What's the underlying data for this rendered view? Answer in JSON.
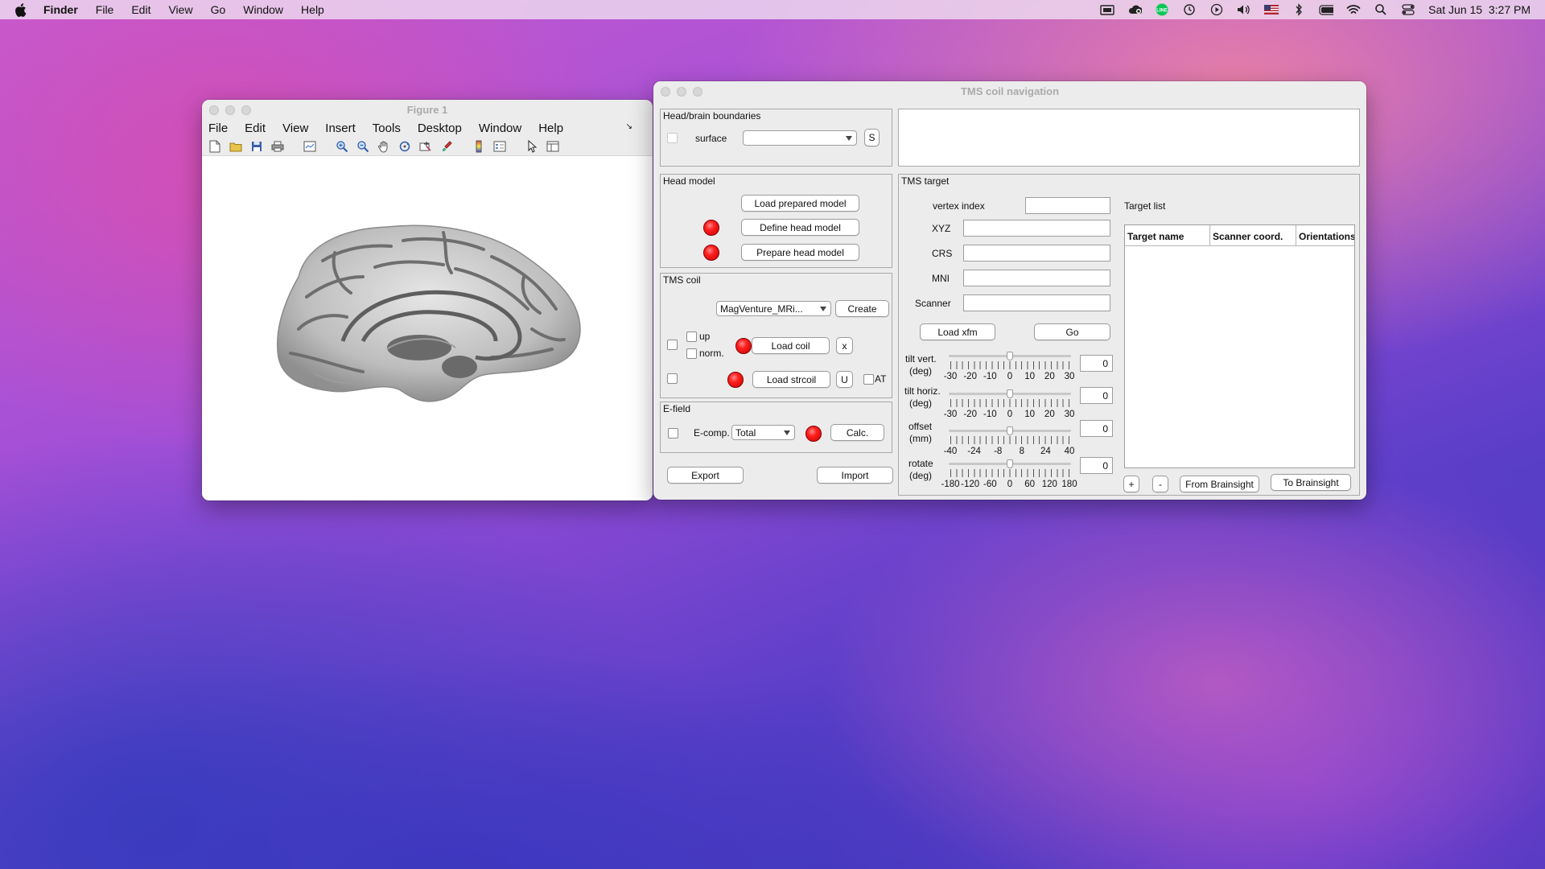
{
  "menubar": {
    "items": [
      "Finder",
      "File",
      "Edit",
      "View",
      "Go",
      "Window",
      "Help"
    ],
    "clock": "Sat Jun 15  3:27 PM",
    "status_icons": [
      "display-icon",
      "cloud-icon",
      "line-app-icon",
      "time-machine-icon",
      "play-icon",
      "volume-icon",
      "flag-us-icon",
      "bluetooth-icon",
      "battery-icon",
      "wifi-icon",
      "spotlight-icon",
      "control-center-icon"
    ]
  },
  "figure": {
    "title": "Figure 1",
    "menu": [
      "File",
      "Edit",
      "View",
      "Insert",
      "Tools",
      "Desktop",
      "Window",
      "Help"
    ],
    "corner_glyph": "↘",
    "toolbar_icons": [
      "new-figure-icon",
      "open-file-icon",
      "save-icon",
      "print-icon",
      "link-plot-icon",
      "zoom-in-icon",
      "zoom-out-icon",
      "pan-icon",
      "rotate-3d-icon",
      "data-cursor-icon",
      "brush-icon",
      "colorbar-icon",
      "legend-icon",
      "edit-plot-icon",
      "property-inspector-icon"
    ]
  },
  "tms": {
    "title": "TMS coil navigation",
    "boundaries": {
      "title": "Head/brain boundaries",
      "surface_label": "surface",
      "surface_value": "",
      "s_button": "S"
    },
    "head_model": {
      "title": "Head model",
      "load_button": "Load prepared model",
      "define_button": "Define head model",
      "prepare_button": "Prepare head model"
    },
    "coil": {
      "title": "TMS coil",
      "coil_select": "MagVenture_MRi...",
      "create_button": "Create",
      "up_label": "up",
      "norm_label": "norm.",
      "load_coil_button": "Load coil",
      "x_button": "x",
      "load_strcoil_button": "Load strcoil",
      "u_button": "U",
      "at_label": "AT"
    },
    "efield": {
      "title": "E-field",
      "ecomp_label": "E-comp.",
      "ecomp_select": "Total",
      "calc_button": "Calc."
    },
    "export_button": "Export",
    "import_button": "Import",
    "target": {
      "title": "TMS target",
      "vertex_label": "vertex index",
      "vertex_value": "",
      "xyz_label": "XYZ",
      "xyz_value": "",
      "crs_label": "CRS",
      "crs_value": "",
      "mni_label": "MNI",
      "mni_value": "",
      "scanner_label": "Scanner",
      "scanner_value": "",
      "load_xfm_button": "Load xfm",
      "go_button": "Go",
      "sliders": [
        {
          "label1": "tilt vert.",
          "label2": "(deg)",
          "value": "0",
          "fraction": 0.5,
          "ticks": [
            "-30",
            "-20",
            "-10",
            "0",
            "10",
            "20",
            "30"
          ]
        },
        {
          "label1": "tilt horiz.",
          "label2": "(deg)",
          "value": "0",
          "fraction": 0.5,
          "ticks": [
            "-30",
            "-20",
            "-10",
            "0",
            "10",
            "20",
            "30"
          ]
        },
        {
          "label1": "offset",
          "label2": "(mm)",
          "value": "0",
          "fraction": 0.5,
          "ticks": [
            "-40",
            "-24",
            "-8",
            "8",
            "24",
            "40"
          ]
        },
        {
          "label1": "rotate",
          "label2": "(deg)",
          "value": "0",
          "fraction": 0.5,
          "ticks": [
            "-180",
            "-120",
            "-60",
            "0",
            "60",
            "120",
            "180"
          ]
        }
      ]
    },
    "target_list": {
      "label": "Target list",
      "columns": [
        "Target name",
        "Scanner coord.",
        "Orientations"
      ],
      "rows": [],
      "plus_button": "+",
      "minus_button": "-",
      "from_button": "From Brainsight",
      "to_button": "To Brainsight"
    }
  }
}
